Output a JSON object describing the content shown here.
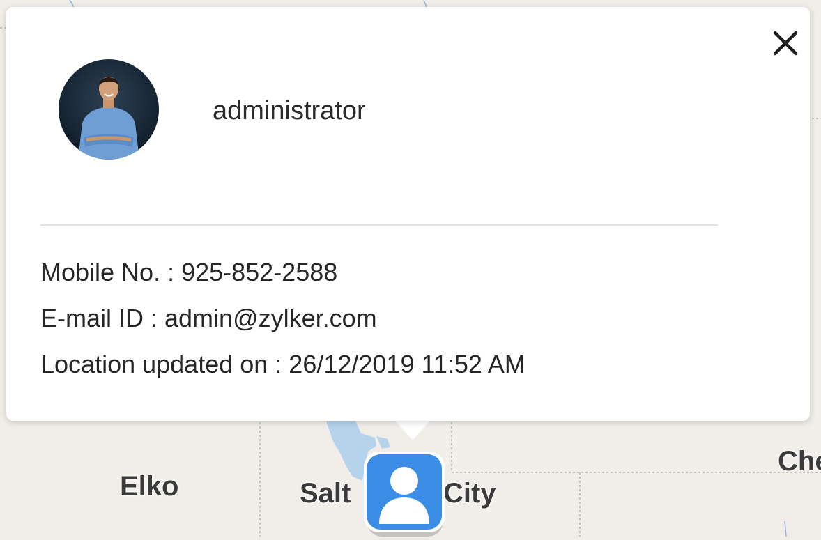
{
  "map": {
    "labels": {
      "elko": "Elko",
      "salt": "Salt",
      "city": "City",
      "che": "Che"
    }
  },
  "popup": {
    "user_name": "administrator",
    "details": {
      "mobile": "Mobile No. : 925-852-2588",
      "email": "E-mail ID : admin@zylker.com",
      "location_updated": "Location updated on : 26/12/2019 11:52 AM"
    }
  },
  "icons": {
    "close": "close-icon",
    "avatar": "user-avatar",
    "marker": "person-icon"
  },
  "colors": {
    "marker_blue": "#3b8de6",
    "map_background": "#f1eeea",
    "water": "#b6d3ec"
  }
}
